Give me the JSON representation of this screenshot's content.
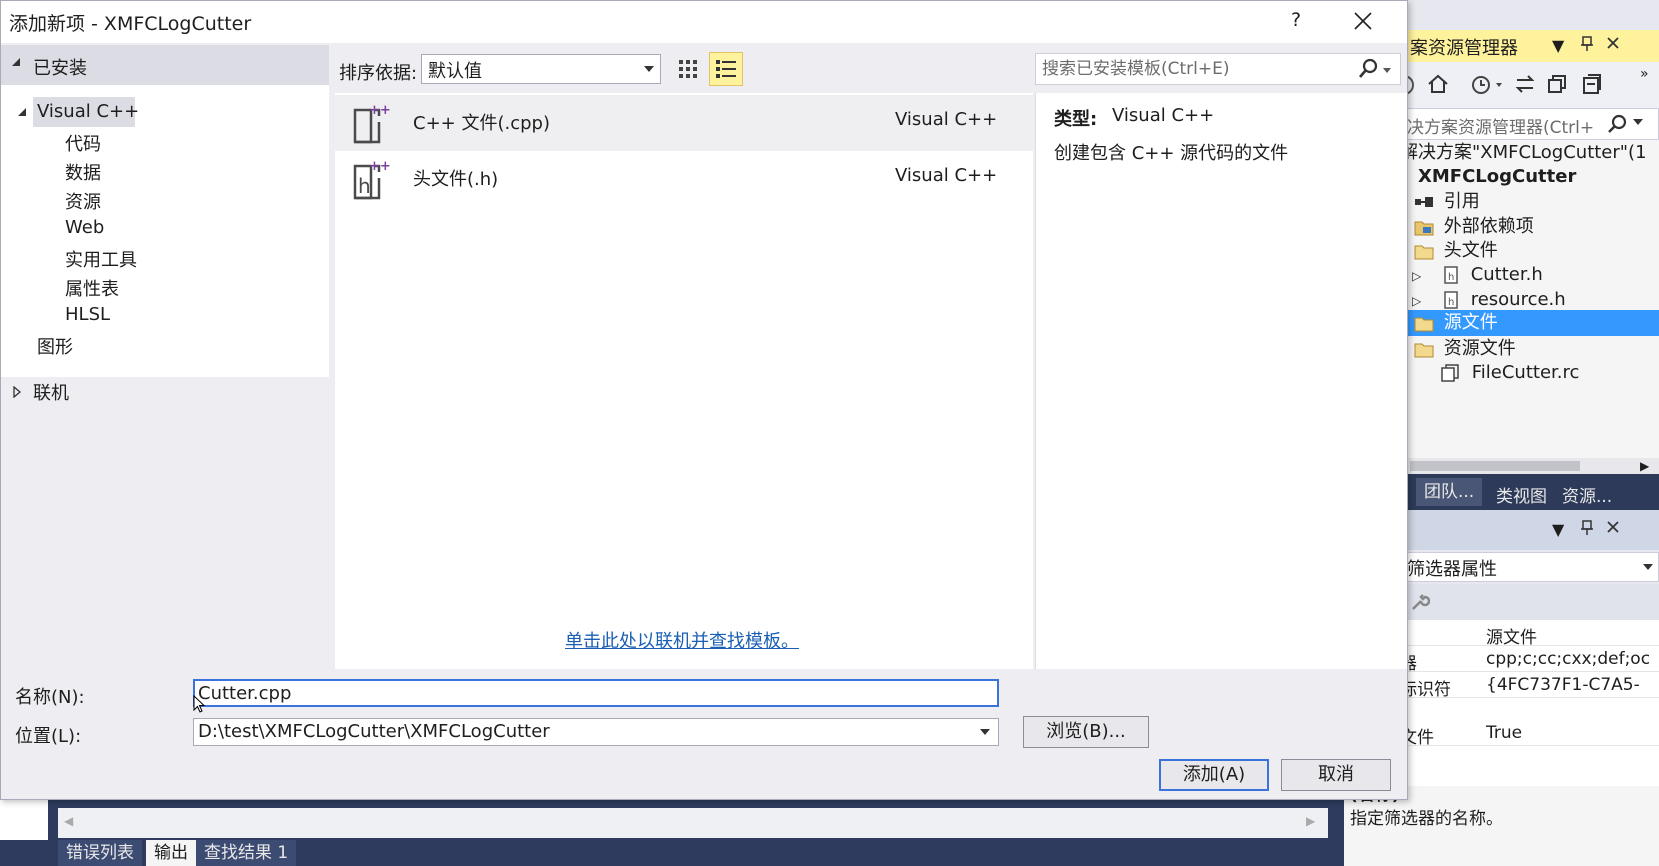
{
  "dialog": {
    "title": "添加新项 - XMFCLogCutter",
    "help": "?"
  },
  "categories": {
    "installed": "已安装",
    "visual_cpp": "Visual C++",
    "items": [
      "代码",
      "数据",
      "资源",
      "Web",
      "实用工具",
      "属性表",
      "HLSL"
    ],
    "graphics": "图形",
    "online": "联机"
  },
  "sort": {
    "label": "排序依据:",
    "value": "默认值"
  },
  "search": {
    "placeholder": "搜索已安装模板(Ctrl+E)"
  },
  "templates": [
    {
      "name": "C++ 文件(.cpp)",
      "lang": "Visual C++",
      "icon": "cpp-file-icon",
      "selected": true
    },
    {
      "name": "头文件(.h)",
      "lang": "Visual C++",
      "icon": "header-file-icon",
      "selected": false
    }
  ],
  "online_link": "单击此处以联机并查找模板。",
  "details": {
    "type_label": "类型:",
    "type_value": "Visual C++",
    "description": "创建包含 C++ 源代码的文件"
  },
  "form": {
    "name_label": "名称(N):",
    "name_value": "Cutter.cpp",
    "location_label": "位置(L):",
    "location_value": "D:\\test\\XMFCLogCutter\\XMFCLogCutter",
    "browse": "浏览(B)...",
    "add": "添加(A)",
    "cancel": "取消"
  },
  "solution_explorer": {
    "title": "案资源管理器",
    "search_placeholder": "决方案资源管理器(Ctrl+",
    "solution_label": "解决方案\"XMFCLogCutter\"(1",
    "project": "XMFCLogCutter",
    "nodes": {
      "references": "引用",
      "external_deps": "外部依赖项",
      "headers": "头文件",
      "cutter_h": "Cutter.h",
      "resource_h": "resource.h",
      "sources": "源文件",
      "resources": "资源文件",
      "filecutter_rc": "FileCutter.rc"
    },
    "tabs": [
      "团队...",
      "类视图",
      "资源..."
    ]
  },
  "properties": {
    "object": "筛选器属性",
    "rows": [
      {
        "key": ")",
        "value": "源文件"
      },
      {
        "key": "器",
        "value": "cpp;c;cc;cxx;def;oc"
      },
      {
        "key": "标识符",
        "value": "{4FC737F1-C7A5-"
      },
      {
        "key": "文件",
        "value": "True"
      }
    ],
    "desc_title": "(名称)",
    "desc_text": "指定筛选器的名称。"
  },
  "bottom_tabs": [
    "错误列表",
    "输出",
    "查找结果 1"
  ],
  "colors": {
    "accent_blue": "#3399ff",
    "highlight_yellow": "#fff29d",
    "link": "#1a5fb4",
    "focus_border": "#3b72dc"
  }
}
